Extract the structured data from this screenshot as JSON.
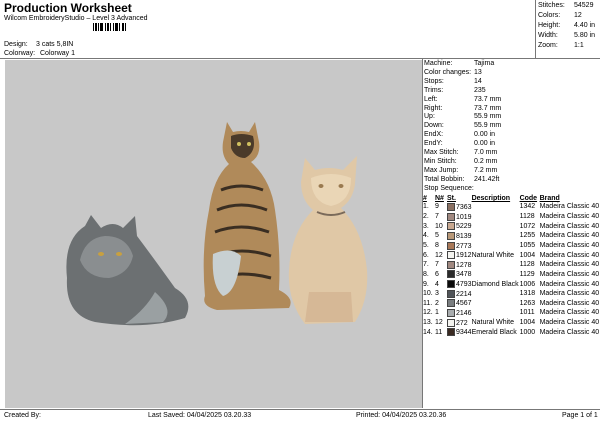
{
  "header": {
    "title": "Production Worksheet",
    "subtitle": "Wilcom EmbroideryStudio – Level 3 Advanced",
    "design_label": "Design:",
    "design_value": "3 cats 5,8IN",
    "colorway_label": "Colorway:",
    "colorway_value": "Colorway 1"
  },
  "top_stats": [
    {
      "label": "Stitches:",
      "value": "54529"
    },
    {
      "label": "Colors:",
      "value": "12"
    },
    {
      "label": "Height:",
      "value": "4.40 in"
    },
    {
      "label": "Width:",
      "value": "5.80 in"
    },
    {
      "label": "Zoom:",
      "value": "1:1"
    }
  ],
  "machine_props": [
    {
      "label": "Machine:",
      "value": "Tajima"
    },
    {
      "label": "Color changes:",
      "value": "13"
    },
    {
      "label": "Stops:",
      "value": "14"
    },
    {
      "label": "Trims:",
      "value": "235"
    },
    {
      "label": "Left:",
      "value": "73.7 mm"
    },
    {
      "label": "Right:",
      "value": "73.7 mm"
    },
    {
      "label": "Up:",
      "value": "55.9 mm"
    },
    {
      "label": "Down:",
      "value": "55.9 mm"
    },
    {
      "label": "EndX:",
      "value": "0.00 in"
    },
    {
      "label": "EndY:",
      "value": "0.00 in"
    },
    {
      "label": "Max Stitch:",
      "value": "7.0 mm"
    },
    {
      "label": "Min Stitch:",
      "value": "0.2 mm"
    },
    {
      "label": "Max Jump:",
      "value": "7.2 mm"
    },
    {
      "label": "Total Bobbin:",
      "value": "241.42ft"
    }
  ],
  "stop_sequence": {
    "title": "Stop Sequence:",
    "headers": {
      "num": "#",
      "n": "N#",
      "st": "St.",
      "desc": "Description",
      "code": "Code",
      "brand": "Brand"
    },
    "rows": [
      {
        "num": "1.",
        "n": "9",
        "color": "#8a7062",
        "st": "7363",
        "desc": "",
        "code": "1342",
        "brand": "Madeira Classic 40"
      },
      {
        "num": "2.",
        "n": "7",
        "color": "#a08880",
        "st": "1019",
        "desc": "",
        "code": "1128",
        "brand": "Madeira Classic 40"
      },
      {
        "num": "3.",
        "n": "10",
        "color": "#c8a890",
        "st": "5229",
        "desc": "",
        "code": "1072",
        "brand": "Madeira Classic 40"
      },
      {
        "num": "4.",
        "n": "5",
        "color": "#b89878",
        "st": "8139",
        "desc": "",
        "code": "1255",
        "brand": "Madeira Classic 40"
      },
      {
        "num": "5.",
        "n": "8",
        "color": "#a87858",
        "st": "2773",
        "desc": "",
        "code": "1055",
        "brand": "Madeira Classic 40"
      },
      {
        "num": "6.",
        "n": "12",
        "color": "#f4f4f0",
        "st": "1912",
        "desc": "Natural White",
        "code": "1004",
        "brand": "Madeira Classic 40"
      },
      {
        "num": "7.",
        "n": "7",
        "color": "#a08880",
        "st": "1278",
        "desc": "",
        "code": "1128",
        "brand": "Madeira Classic 40"
      },
      {
        "num": "8.",
        "n": "6",
        "color": "#2a2a2a",
        "st": "3478",
        "desc": "",
        "code": "1129",
        "brand": "Madeira Classic 40"
      },
      {
        "num": "9.",
        "n": "4",
        "color": "#0a0a0a",
        "st": "4793",
        "desc": "Diamond Black",
        "code": "1006",
        "brand": "Madeira Classic 40"
      },
      {
        "num": "10.",
        "n": "3",
        "color": "#505458",
        "st": "2214",
        "desc": "",
        "code": "1318",
        "brand": "Madeira Classic 40"
      },
      {
        "num": "11.",
        "n": "2",
        "color": "#7a7e80",
        "st": "4567",
        "desc": "",
        "code": "1263",
        "brand": "Madeira Classic 40"
      },
      {
        "num": "12.",
        "n": "1",
        "color": "#a8acae",
        "st": "2146",
        "desc": "",
        "code": "1011",
        "brand": "Madeira Classic 40"
      },
      {
        "num": "13.",
        "n": "12",
        "color": "#f4f4f0",
        "st": "272",
        "desc": "Natural White",
        "code": "1004",
        "brand": "Madeira Classic 40"
      },
      {
        "num": "14.",
        "n": "11",
        "color": "#3a2a22",
        "st": "9344",
        "desc": "Emerald Black",
        "code": "1000",
        "brand": "Madeira Classic 40"
      }
    ]
  },
  "footer": {
    "created": "Created By:",
    "last_saved": "Last Saved: 04/04/2025 03.20.33",
    "printed": "Printed: 04/04/2025 03.20.36",
    "page": "Page 1 of 1"
  }
}
